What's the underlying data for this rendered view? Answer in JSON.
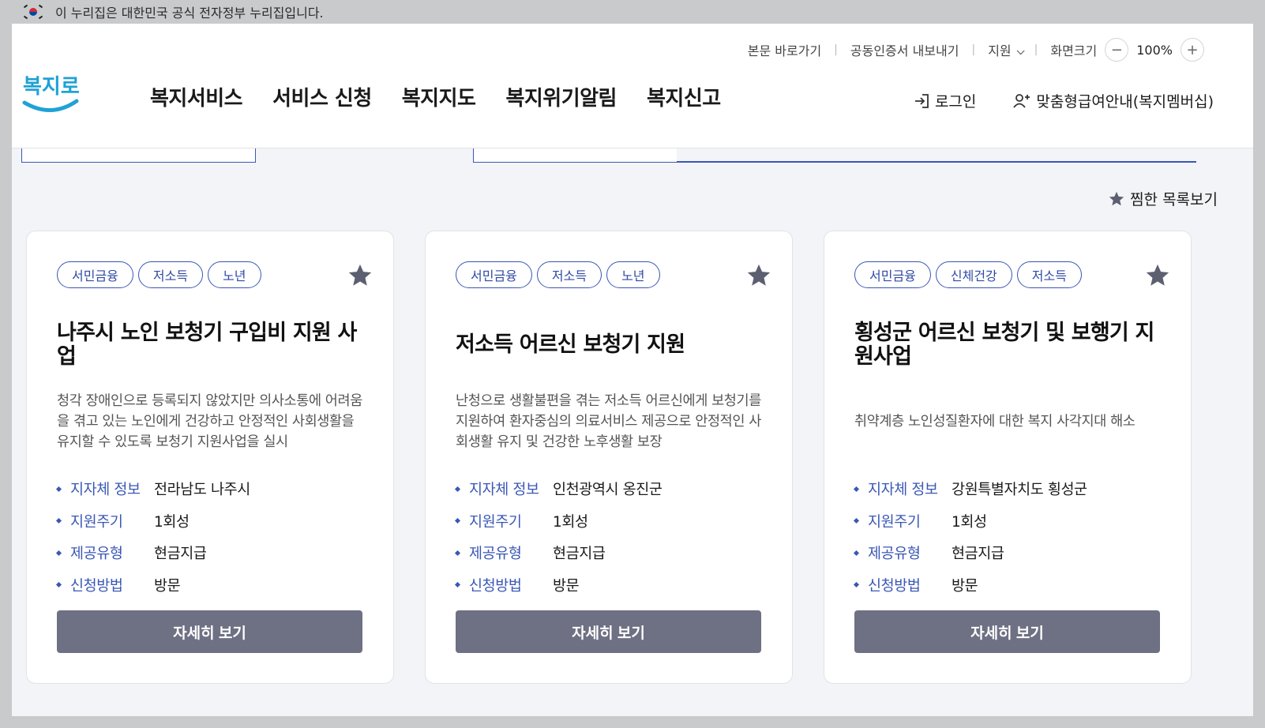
{
  "gov_banner": {
    "text": "이 누리집은 대한민국 공식 전자정부 누리집입니다."
  },
  "utility": {
    "skip_to_content": "본문 바로가기",
    "export_cert": "공동인증서 내보내기",
    "support": "지원",
    "screen_size_label": "화면크기",
    "zoom_minus": "−",
    "zoom_value": "100%",
    "zoom_plus": "+"
  },
  "logo": {
    "text": "복지로"
  },
  "gnb": [
    "복지서비스",
    "서비스 신청",
    "복지지도",
    "복지위기알림",
    "복지신고"
  ],
  "user_links": {
    "login": "로그인",
    "membership": "맞춤형급여안내(복지멤버십)"
  },
  "favorites_link": "찜한 목록보기",
  "cards": [
    {
      "tags": [
        "서민금융",
        "저소득",
        "노년"
      ],
      "title": "나주시 노인 보청기 구입비 지원 사업",
      "desc": "청각 장애인으로 등록되지 않았지만 의사소통에 어려움을 겪고 있는 노인에게 건강하고 안정적인 사회생활을 유지할 수 있도록 보청기 지원사업을 실시",
      "info": [
        {
          "k": "지자체 정보",
          "v": "전라남도 나주시"
        },
        {
          "k": "지원주기",
          "v": "1회성"
        },
        {
          "k": "제공유형",
          "v": "현금지급"
        },
        {
          "k": "신청방법",
          "v": "방문"
        }
      ],
      "button": "자세히 보기"
    },
    {
      "tags": [
        "서민금융",
        "저소득",
        "노년"
      ],
      "title": "저소득 어르신 보청기 지원",
      "desc": "난청으로 생활불편을 겪는 저소득 어르신에게 보청기를 지원하여 환자중심의 의료서비스 제공으로 안정적인 사회생활 유지 및 건강한 노후생활 보장",
      "info": [
        {
          "k": "지자체 정보",
          "v": "인천광역시 옹진군"
        },
        {
          "k": "지원주기",
          "v": "1회성"
        },
        {
          "k": "제공유형",
          "v": "현금지급"
        },
        {
          "k": "신청방법",
          "v": "방문"
        }
      ],
      "button": "자세히 보기"
    },
    {
      "tags": [
        "서민금융",
        "신체건강",
        "저소득"
      ],
      "title": "횡성군 어르신 보청기 및 보행기 지원사업",
      "desc": "취약계층 노인성질환자에 대한 복지 사각지대 해소",
      "info": [
        {
          "k": "지자체 정보",
          "v": "강원특별자치도 횡성군"
        },
        {
          "k": "지원주기",
          "v": "1회성"
        },
        {
          "k": "제공유형",
          "v": "현금지급"
        },
        {
          "k": "신청방법",
          "v": "방문"
        }
      ],
      "button": "자세히 보기"
    }
  ],
  "colors": {
    "accent": "#3a57b5",
    "button": "#6e7083",
    "star": "#5c5f70",
    "logo": "#1fa2d6"
  }
}
